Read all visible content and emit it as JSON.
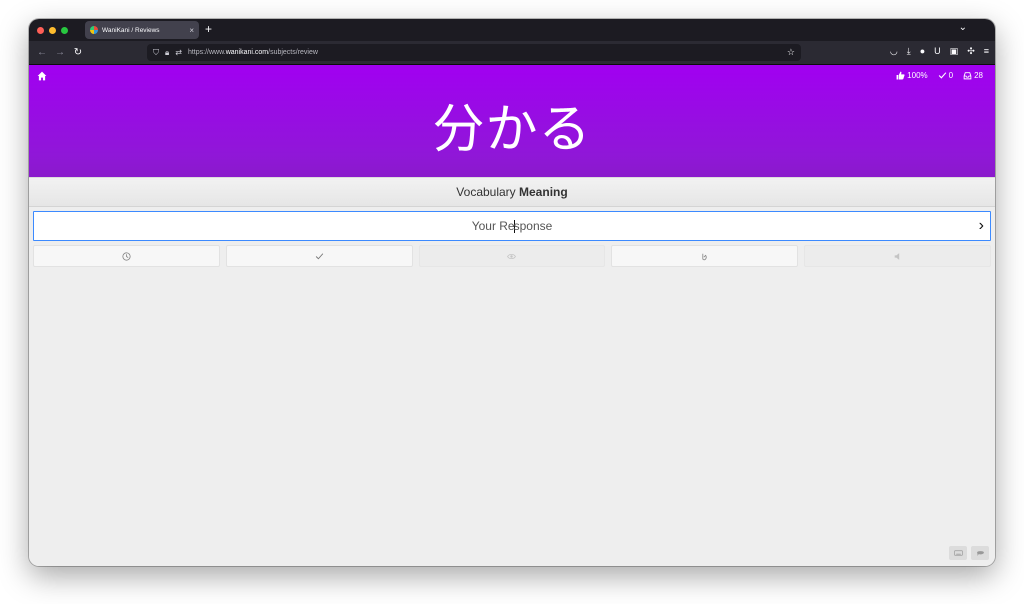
{
  "browser": {
    "tab_title": "WaniKani / Reviews",
    "tab_close": "×",
    "new_tab": "+",
    "url_prefix": "https://www.",
    "url_domain": "wanikani.com",
    "url_path": "/subjects/review"
  },
  "header": {
    "home_icon": "home-icon",
    "stats": {
      "percent_correct": "100%",
      "completed": "0",
      "remaining": "28"
    },
    "character": "分かる",
    "background_color": "#a100f1"
  },
  "question": {
    "type": "Vocabulary",
    "category": "Meaning"
  },
  "answer": {
    "text_before_caret": "Your Re",
    "text_after_caret": "sponse",
    "submit_icon": "chevron-right-icon",
    "border_color": "#3c8aff"
  },
  "action_buttons": [
    {
      "icon": "clock-icon",
      "enabled": true
    },
    {
      "icon": "check-icon",
      "enabled": true
    },
    {
      "icon": "eye-icon",
      "enabled": false
    },
    {
      "icon": "undo-icon",
      "enabled": true
    },
    {
      "icon": "audio-icon",
      "enabled": false
    }
  ],
  "corner_buttons": [
    "keyboard-icon",
    "chat-icon"
  ]
}
